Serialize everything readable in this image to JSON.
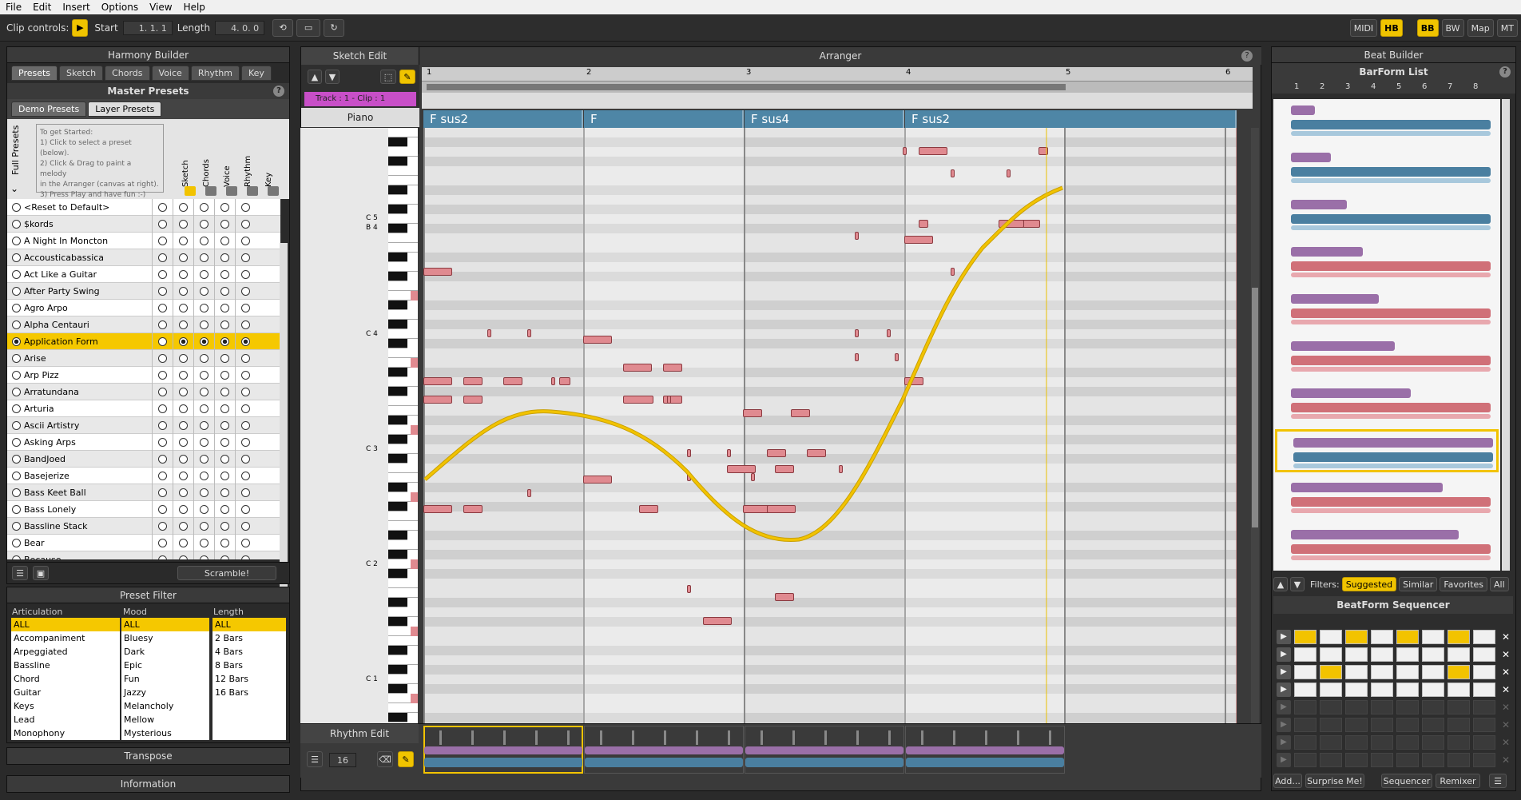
{
  "menu": [
    "File",
    "Edit",
    "Insert",
    "Options",
    "View",
    "Help"
  ],
  "toolbar": {
    "clip_controls": "Clip controls:",
    "start_label": "Start",
    "start_value": "1. 1. 1",
    "length_label": "Length",
    "length_value": "4. 0. 0",
    "right_buttons": [
      "MIDI",
      "HB",
      "BB",
      "BW",
      "Map",
      "MT"
    ]
  },
  "harmony": {
    "title": "Harmony Builder",
    "tabs": [
      "Presets",
      "Sketch",
      "Chords",
      "Voice",
      "Rhythm",
      "Key"
    ],
    "master_presets": "Master Presets",
    "subtabs": [
      "Demo Presets",
      "Layer Presets"
    ],
    "full_presets": "Full Presets",
    "help_text": [
      "To get Started:",
      "1) Click to select a preset (below).",
      "2) Click & Drag to paint a melody",
      "in the Arranger (canvas at right).",
      "3) Press Play and have fun :-)"
    ],
    "columns": [
      "Sketch",
      "Chords",
      "Voice",
      "Rhythm",
      "Key"
    ],
    "presets": [
      "<Reset to Default>",
      "$kords",
      "A Night In Moncton",
      "Accousticabassica",
      "Act Like a Guitar",
      "After Party Swing",
      "Agro Arpo",
      "Alpha Centauri",
      "Application Form",
      "Arise",
      "Arp Pizz",
      "Arratundana",
      "Arturia",
      "Ascii Artistry",
      "Asking Arps",
      "BandJoed",
      "Basejerize",
      "Bass Keet Ball",
      "Bass Lonely",
      "Bassline Stack",
      "Bear",
      "Because"
    ],
    "selected_index": 8,
    "scramble": "Scramble!"
  },
  "filter": {
    "title": "Preset Filter",
    "articulation_label": "Articulation",
    "mood_label": "Mood",
    "length_label": "Length",
    "articulation": [
      "ALL",
      "Accompaniment",
      "Arpeggiated",
      "Bassline",
      "Chord",
      "Guitar",
      "Keys",
      "Lead",
      "Monophony"
    ],
    "mood": [
      "ALL",
      "Bluesy",
      "Dark",
      "Epic",
      "Fun",
      "Jazzy",
      "Melancholy",
      "Mellow",
      "Mysterious"
    ],
    "length": [
      "ALL",
      "2 Bars",
      "4 Bars",
      "8 Bars",
      "12 Bars",
      "16 Bars"
    ]
  },
  "transpose": "Transpose",
  "information": "Information",
  "sketch_edit": "Sketch Edit",
  "arranger": {
    "title": "Arranger",
    "track_label": "Track : 1 - Clip : 1",
    "piano": "Piano",
    "bars": [
      "1",
      "2",
      "3",
      "4",
      "5",
      "6"
    ],
    "chords": [
      "F sus2",
      "F",
      "F sus4",
      "F sus2"
    ],
    "note_labels": [
      "C 5",
      "B 4",
      "C 4",
      "C 3",
      "C 2",
      "C 1"
    ]
  },
  "rhythm_edit": {
    "title": "Rhythm Edit",
    "value": "16"
  },
  "beat_builder": {
    "title": "Beat Builder",
    "barform_list": "BarForm List",
    "columns": [
      "1",
      "2",
      "3",
      "4",
      "5",
      "6",
      "7",
      "8"
    ],
    "filters_label": "Filters:",
    "filters": [
      "Suggested",
      "Similar",
      "Favorites",
      "All"
    ],
    "sequencer_title": "BeatForm Sequencer",
    "bottom_buttons": [
      "Add...",
      "Surprise Me!",
      "Sequencer",
      "Remixer"
    ]
  },
  "colors": {
    "accent": "#f2c300",
    "chord_blue": "#4e86a6",
    "note_pink": "#e08a90",
    "curve": "#e8bc00"
  }
}
